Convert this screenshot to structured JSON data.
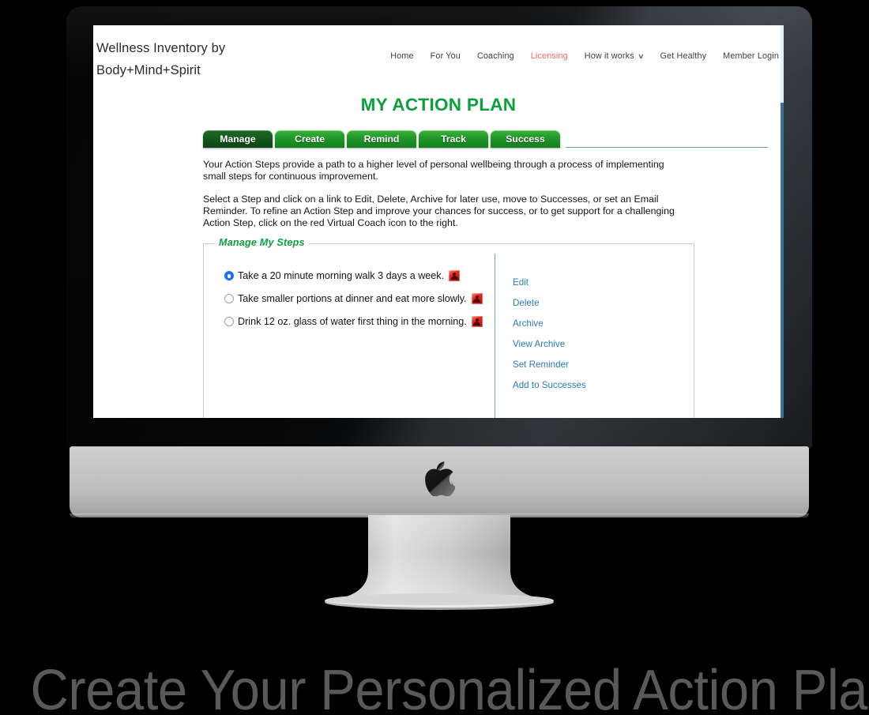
{
  "device": {
    "kind": "imac-desktop-monitor",
    "logo": "apple-logo"
  },
  "site": {
    "brand_line1": "Wellness Inventory by",
    "brand_line2": "Body+Mind+Spirit",
    "brand": "Wellness Inventory by\nBody+Mind+Spirit",
    "accent_color": "#f1695f",
    "nav": [
      {
        "label": "Home",
        "accent": false
      },
      {
        "label": "For You",
        "accent": false
      },
      {
        "label": "Coaching",
        "accent": false
      },
      {
        "label": "Licensing",
        "accent": true
      },
      {
        "label": "How it works",
        "accent": false,
        "caret": "chevron-down-icon"
      },
      {
        "label": "Get Healthy",
        "accent": false
      },
      {
        "label": "Member Login",
        "accent": false
      }
    ],
    "nav_caret_glyph": "∨"
  },
  "page": {
    "title": "MY ACTION PLAN",
    "title_color": "#0aa03c",
    "tabs": [
      {
        "label": "Manage",
        "active": true
      },
      {
        "label": "Create",
        "active": false
      },
      {
        "label": "Remind",
        "active": false
      },
      {
        "label": "Track",
        "active": false
      },
      {
        "label": "Success",
        "active": false
      }
    ],
    "intro": [
      "Your Action Steps provide a path to a higher level of personal wellbeing through a process of implementing small steps for continuous improvement.",
      "Select a Step and click on a link to Edit, Delete, Archive for later use, move to Successes, or set an Email Reminder. To refine an Action Step and improve your chances for success, or to get support for a challenging Action Step, click on the red Virtual Coach icon to the right."
    ]
  },
  "steps_panel": {
    "legend": "Manage My Steps",
    "legend_color": "#0aa03c",
    "steps": [
      {
        "label": "Take a 20 minute morning walk 3 days a week.",
        "selected": true,
        "coach_icon": "virtual-coach-icon"
      },
      {
        "label": "Take smaller portions at dinner and eat more slowly.",
        "selected": false,
        "coach_icon": "virtual-coach-icon"
      },
      {
        "label": "Drink 12 oz. glass of water first thing in the morning.",
        "selected": false,
        "coach_icon": "virtual-coach-icon"
      }
    ],
    "actions": [
      {
        "label": "Edit"
      },
      {
        "label": "Delete"
      },
      {
        "label": "Archive"
      },
      {
        "label": "View Archive"
      },
      {
        "label": "Set Reminder"
      },
      {
        "label": "Add to Successes"
      }
    ],
    "link_color": "#2b7cb8"
  },
  "caption": {
    "text": "Create Your Personalized Action Plan",
    "color": "#58595b"
  }
}
